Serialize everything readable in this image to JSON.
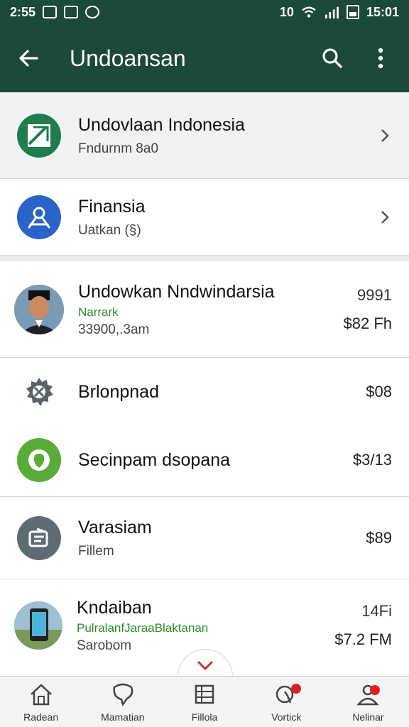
{
  "status_bar": {
    "time": "2:55",
    "right_text": "15:01",
    "indicator": "10"
  },
  "app_bar": {
    "title": "Undoansan",
    "back_icon": "arrow-left-icon",
    "search_icon": "search-icon",
    "menu_icon": "more-vert-icon"
  },
  "items": [
    {
      "primary": "Undovlaan Indonesia",
      "secondary": "Fndurnm 8a0",
      "icon": "document-check-icon",
      "color": "#1e7d4e"
    },
    {
      "primary": "Finansia",
      "secondary": "Uatkan (§)",
      "icon": "person-connect-icon",
      "color": "#2a63c9"
    },
    {
      "primary": "Undowkan Nndwindarsia",
      "green": "Narrark",
      "secondary": "33900,.3am",
      "amount_top": "9991",
      "amount": "$82 Fh",
      "icon": "person-photo"
    },
    {
      "primary": "Brlonpnad",
      "amount": "$08",
      "icon": "gear-tools-icon"
    },
    {
      "primary": "Secinpam dsopana",
      "amount": "$3/13",
      "icon": "circle-leaf-icon",
      "color": "#5aac3a"
    },
    {
      "primary": "Varasiam",
      "secondary": "Fillem",
      "amount": "$89",
      "icon": "wallet-icon",
      "color": "#5e6b72"
    },
    {
      "primary": "Kndaiban",
      "green": "PulralanfJaraaBlaktanan",
      "secondary": "Sarobom",
      "amount_top": "14Fi",
      "amount": "$7.2 FM",
      "icon": "phone-photo"
    }
  ],
  "bottom_nav": [
    {
      "label": "Radean",
      "icon": "home-icon"
    },
    {
      "label": "Mamatian",
      "icon": "chat-bubble-icon"
    },
    {
      "label": "Fillola",
      "icon": "list-icon"
    },
    {
      "label": "Vortick",
      "icon": "notification-icon"
    },
    {
      "label": "Nelinar",
      "icon": "profile-icon"
    }
  ],
  "colors": {
    "primary": "#1b4a3a",
    "accent": "#d32f2f",
    "green_text": "#2e8b2e"
  }
}
